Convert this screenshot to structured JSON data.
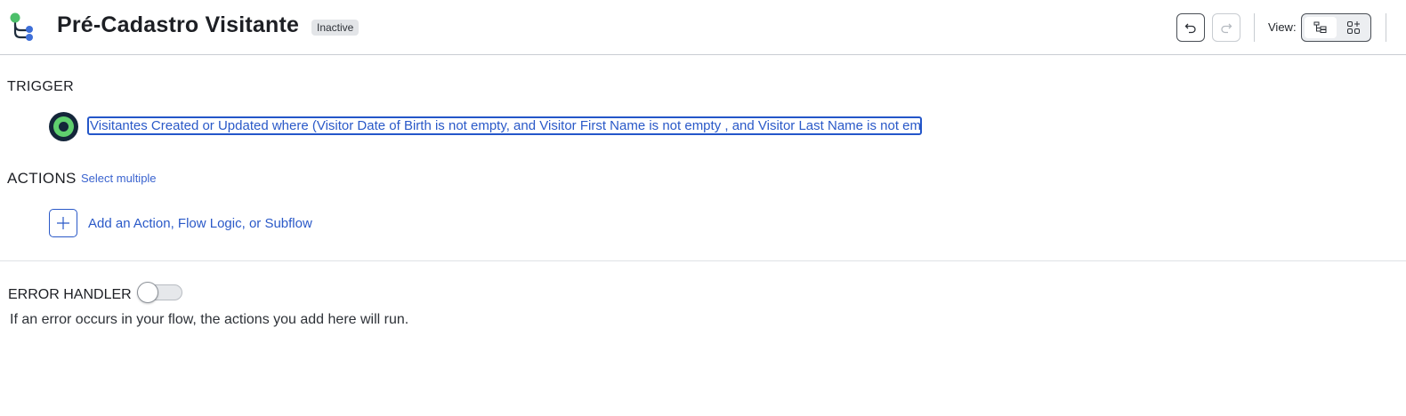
{
  "header": {
    "title": "Pré-Cadastro Visitante",
    "status": "Inactive",
    "view_label": "View:",
    "icons": {
      "flow": "flow-tree-icon",
      "undo": "undo-icon",
      "redo": "redo-icon",
      "tree_view": "tree-view-icon",
      "grid_view": "grid-view-icon"
    }
  },
  "trigger": {
    "heading": "TRIGGER",
    "description": "Visitantes Created or Updated where (Visitor Date of Birth is not empty, and Visitor First Name is not empty , and Visitor Last Name is not empty )"
  },
  "actions": {
    "heading": "ACTIONS",
    "select_multiple": "Select multiple",
    "add_label": "Add an Action, Flow Logic, or Subflow"
  },
  "error_handler": {
    "heading": "ERROR HANDLER",
    "enabled": false,
    "description": "If an error occurs in your flow, the actions you add here will run."
  },
  "colors": {
    "accent": "#2a59c8",
    "trigger_green": "#5fcf6e",
    "trigger_dark": "#14263a",
    "badge_bg": "#e3e5e8"
  }
}
